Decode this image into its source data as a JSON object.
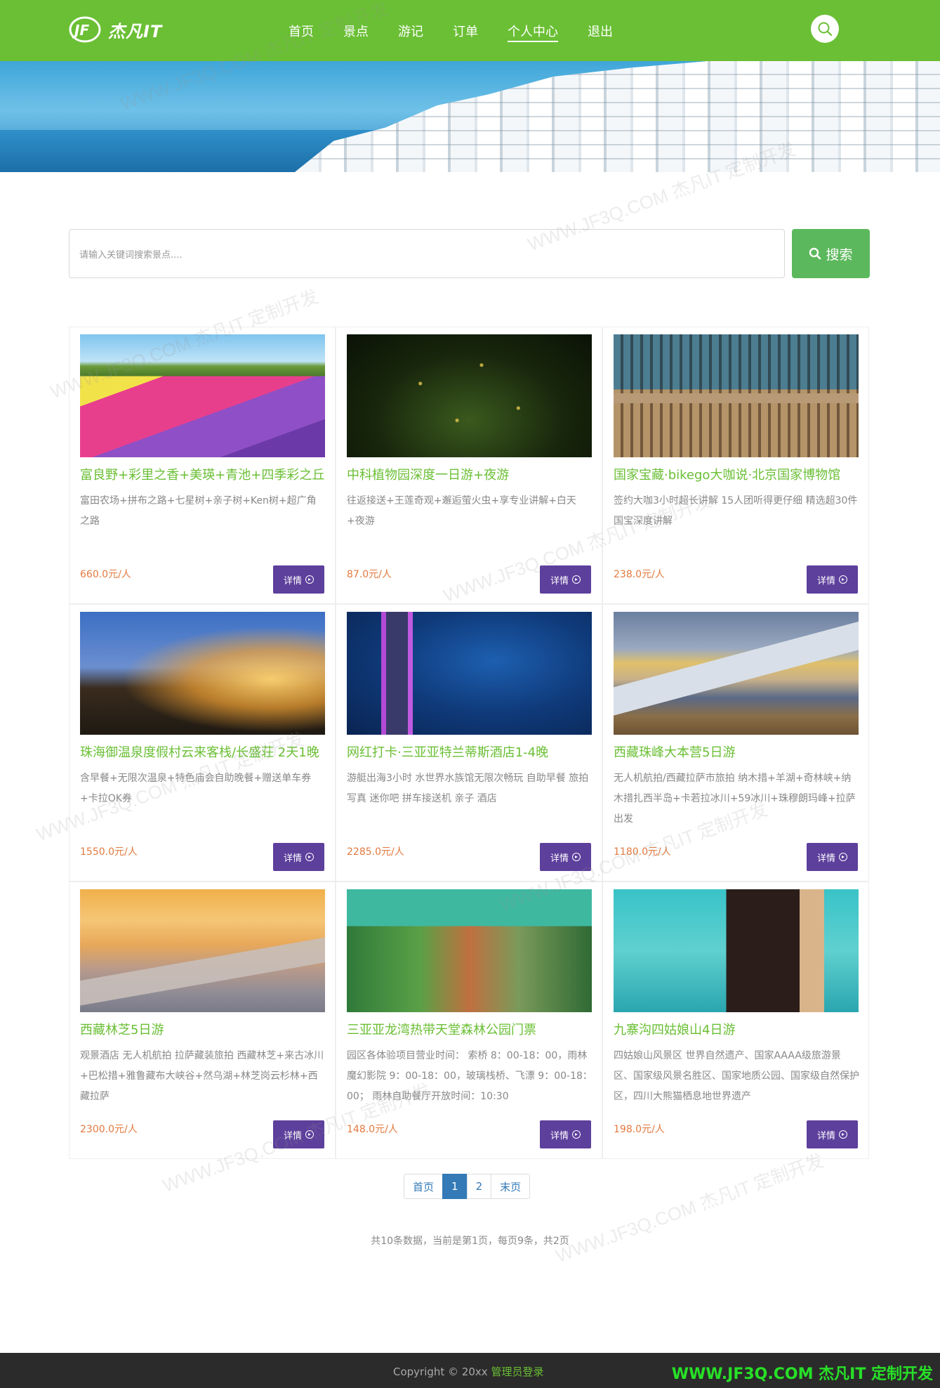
{
  "header": {
    "logo_text": "杰凡IT",
    "nav": [
      "首页",
      "景点",
      "游记",
      "订单",
      "个人中心",
      "退出"
    ],
    "active_nav": "个人中心"
  },
  "search": {
    "placeholder": "请输入关键词搜索景点....",
    "button_label": "搜索"
  },
  "cards": [
    {
      "title": "富良野+彩里之香+美瑛+青池+四季彩之丘",
      "desc": "富田农场+拼布之路+七星树+亲子树+Ken树+超广角之路",
      "price": "660.0元/人",
      "button": "详情"
    },
    {
      "title": "中科植物园深度一日游+夜游",
      "desc": "往返接送+王莲奇观+邂逅萤火虫+享专业讲解+白天+夜游",
      "price": "87.0元/人",
      "button": "详情"
    },
    {
      "title": "国家宝藏·bikego大咖说·北京国家博物馆",
      "desc": "签约大咖3小时超长讲解 15人团听得更仔细 精选超30件国宝深度讲解",
      "price": "238.0元/人",
      "button": "详情"
    },
    {
      "title": "珠海御温泉度假村云来客栈/长盛荘 2天1晚",
      "desc": "含早餐+无限次温泉+特色庙会自助晚餐+赠送单车券+卡拉OK券",
      "price": "1550.0元/人",
      "button": "详情"
    },
    {
      "title": "网红打卡·三亚亚特兰蒂斯酒店1-4晚",
      "desc": "游艇出海3小时 水世界水族馆无限次畅玩 自助早餐 旅拍写真 迷你吧 拼车接送机 亲子 酒店",
      "price": "2285.0元/人",
      "button": "详情"
    },
    {
      "title": "西藏珠峰大本营5日游",
      "desc": "无人机航拍/西藏拉萨市旅拍 纳木措+羊湖+奇林峡+纳木措扎西半岛+卡若拉冰川+59冰川+珠穆朗玛峰+拉萨出发",
      "price": "1180.0元/人",
      "button": "详情"
    },
    {
      "title": "西藏林芝5日游",
      "desc": "观景酒店 无人机航拍 拉萨藏装旅拍 西藏林芝+来古冰川+巴松措+雅鲁藏布大峡谷+然乌湖+林芝岗云杉林+西藏拉萨",
      "price": "2300.0元/人",
      "button": "详情"
    },
    {
      "title": "三亚亚龙湾热带天堂森林公园门票",
      "desc": "园区各体验项目营业时间： 索桥 8：00-18：00，雨林魔幻影院 9：00-18：00，玻璃栈桥、飞漂 9：00-18：00； 雨林自助餐厅开放时间：10:30",
      "price": "148.0元/人",
      "button": "详情"
    },
    {
      "title": "九寨沟四姑娘山4日游",
      "desc": "四姑娘山风景区 世界自然遗产、国家AAAA级旅游景区、国家级风景名胜区、国家地质公园、国家级自然保护区，四川大熊猫栖息地世界遗产",
      "price": "198.0元/人",
      "button": "详情"
    }
  ],
  "pagination": {
    "first": "首页",
    "pages": [
      "1",
      "2"
    ],
    "current": "1",
    "last": "末页",
    "info": "共10条数据，当前是第1页，每页9条，共2页"
  },
  "footer": {
    "copyright": "Copyright © 20xx",
    "admin_link": "管理员登录",
    "brand": "WWW.JF3Q.COM 杰凡IT  定制开发"
  },
  "watermark": "WWW.JF3Q.COM 杰凡IT  定制开发",
  "colors": {
    "brand_green": "#6abf34",
    "search_green": "#5cb85c",
    "detail_purple": "#5d3f9c",
    "price_orange": "#e27a3f",
    "pager_blue": "#337ab7"
  }
}
